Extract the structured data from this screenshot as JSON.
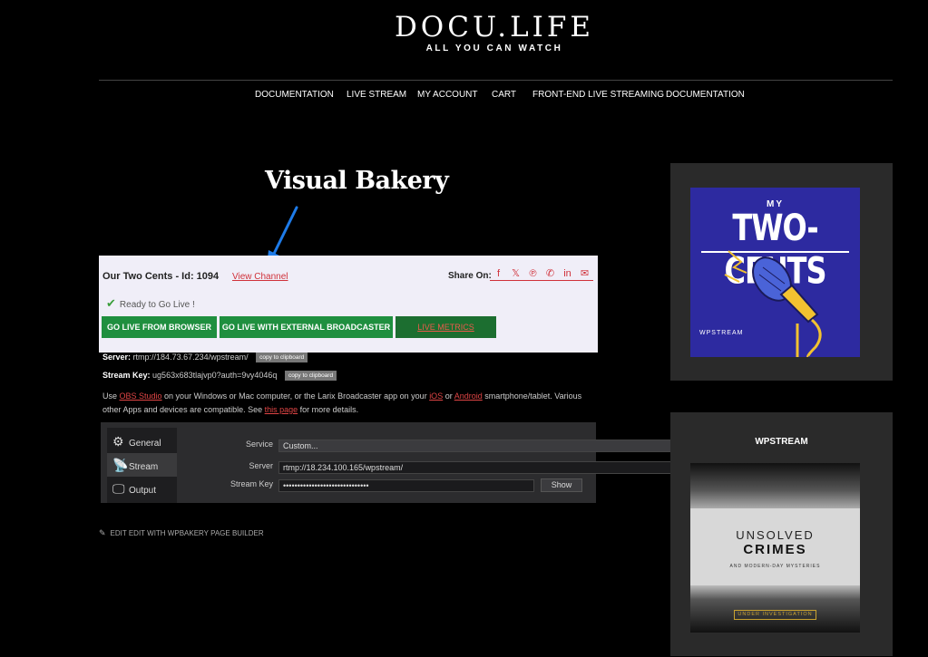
{
  "site": {
    "title": "DOCU.LIFE",
    "tagline": "ALL YOU CAN WATCH"
  },
  "nav": {
    "items": [
      {
        "label": "DOCUMENTATION"
      },
      {
        "label": "LIVE STREAM"
      },
      {
        "label": "MY ACCOUNT"
      },
      {
        "label": "CART"
      },
      {
        "label": "FRONT-END LIVE STREAMING"
      },
      {
        "label": "DOCUMENTATION"
      }
    ]
  },
  "annotation": {
    "title": "Visual Bakery",
    "arrow_color": "#1e7be8"
  },
  "channel": {
    "title": "Our Two Cents - Id: 1094",
    "view_channel": "View Channel",
    "share_label": "Share On:",
    "share_icons": [
      "facebook-icon",
      "twitter-icon",
      "pinterest-icon",
      "whatsapp-icon",
      "linkedin-icon",
      "email-icon"
    ],
    "status": "Ready to Go Live !",
    "buttons": {
      "browser": "GO LIVE FROM BROWSER",
      "external": "GO LIVE WITH EXTERNAL BROADCASTER",
      "metrics": "LIVE METRICS"
    },
    "server_label": "Server:",
    "server_value": "rtmp://184.73.67.234/wpstream/",
    "stream_key_label": "Stream Key:",
    "stream_key_value": "ug563x683tlajvp0?auth=9vy4046q",
    "copy_label": "copy to clipboard",
    "description": {
      "part1": "Use ",
      "obs_link": "OBS Studio",
      "part2": " on your Windows or Mac computer, or the Larix Broadcaster app on your ",
      "ios_link": "iOS",
      "part3": " or ",
      "android_link": "Android",
      "part4": " smartphone/tablet. Various other Apps and devices are compatible. See ",
      "this_page_link": "this page",
      "part5": " for more details."
    }
  },
  "obs": {
    "tabs": [
      {
        "label": "General",
        "icon": "gear-icon"
      },
      {
        "label": "Stream",
        "icon": "antenna-icon"
      },
      {
        "label": "Output",
        "icon": "monitor-icon"
      }
    ],
    "service_label": "Service",
    "service_value": "Custom...",
    "server_label": "Server",
    "server_value": "rtmp://18.234.100.165/wpstream/",
    "stream_key_label": "Stream Key",
    "stream_key_value": "••••••••••••••••••••••••••••••",
    "show_label": "Show"
  },
  "edit": {
    "label": "EDIT EDIT WITH WPBAKERY PAGE BUILDER"
  },
  "sidebar": {
    "podcast1": {
      "line1": "MY",
      "line2": "TWO-CENTS",
      "brand": "WPSTREAM",
      "bg": "#2d2aa0"
    },
    "widget2_title": "WPSTREAM",
    "podcast2": {
      "line1": "UNSOLVED",
      "line2": "CRIMES",
      "line3": "AND MODERN-DAY MYSTERIES",
      "badge": "UNDER INVESTIGATION"
    }
  }
}
